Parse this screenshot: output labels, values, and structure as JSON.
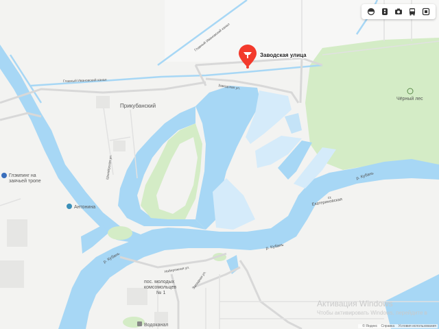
{
  "marker": {
    "label": "Заводская улица"
  },
  "labels": {
    "prikubansky": "Прикубанский",
    "chernyi_les": "Чёрный лес",
    "kuban_1": "р. Кубань",
    "kuban_2": "р. Кубань",
    "kuban_3": "р. Кубань",
    "ekaterinovskaya": "Екатериновская",
    "ekaterinovskaya_prefix": "ст.",
    "antonina": "Антонина",
    "glamping_1": "Глэмпинг на",
    "glamping_2": "заячьей тропе",
    "kanal_1": "Главный Ивановский канал",
    "kanal_2": "Главный Ивановский канал",
    "zavodskaya_street": "Заводская ул.",
    "street_v": "Шкипёрская ул.",
    "pos_1": "пос. молодых",
    "pos_2": "комсомольцев",
    "pos_3": "№ 1",
    "vodokanal": "Водоканал",
    "zapadnaya": "Западная ул.",
    "naberezhnaya": "Набережная ул."
  },
  "toolbar": {
    "icons": [
      "layers-icon",
      "traffic-icon",
      "camera-icon",
      "bus-icon",
      "fullscreen-icon"
    ]
  },
  "watermark": {
    "line1": "Активация Windows",
    "line2": "Чтобы активировать Windows, перейдите в"
  },
  "copyright": {
    "yandex": "© Яндекс",
    "help": "Справка",
    "terms": "Условия использования"
  },
  "colors": {
    "water": "#a7d7f5",
    "forest": "#d4ecc6",
    "land": "#f3f3f1",
    "road": "#d6d6d6",
    "marker": "#f33a2c"
  }
}
